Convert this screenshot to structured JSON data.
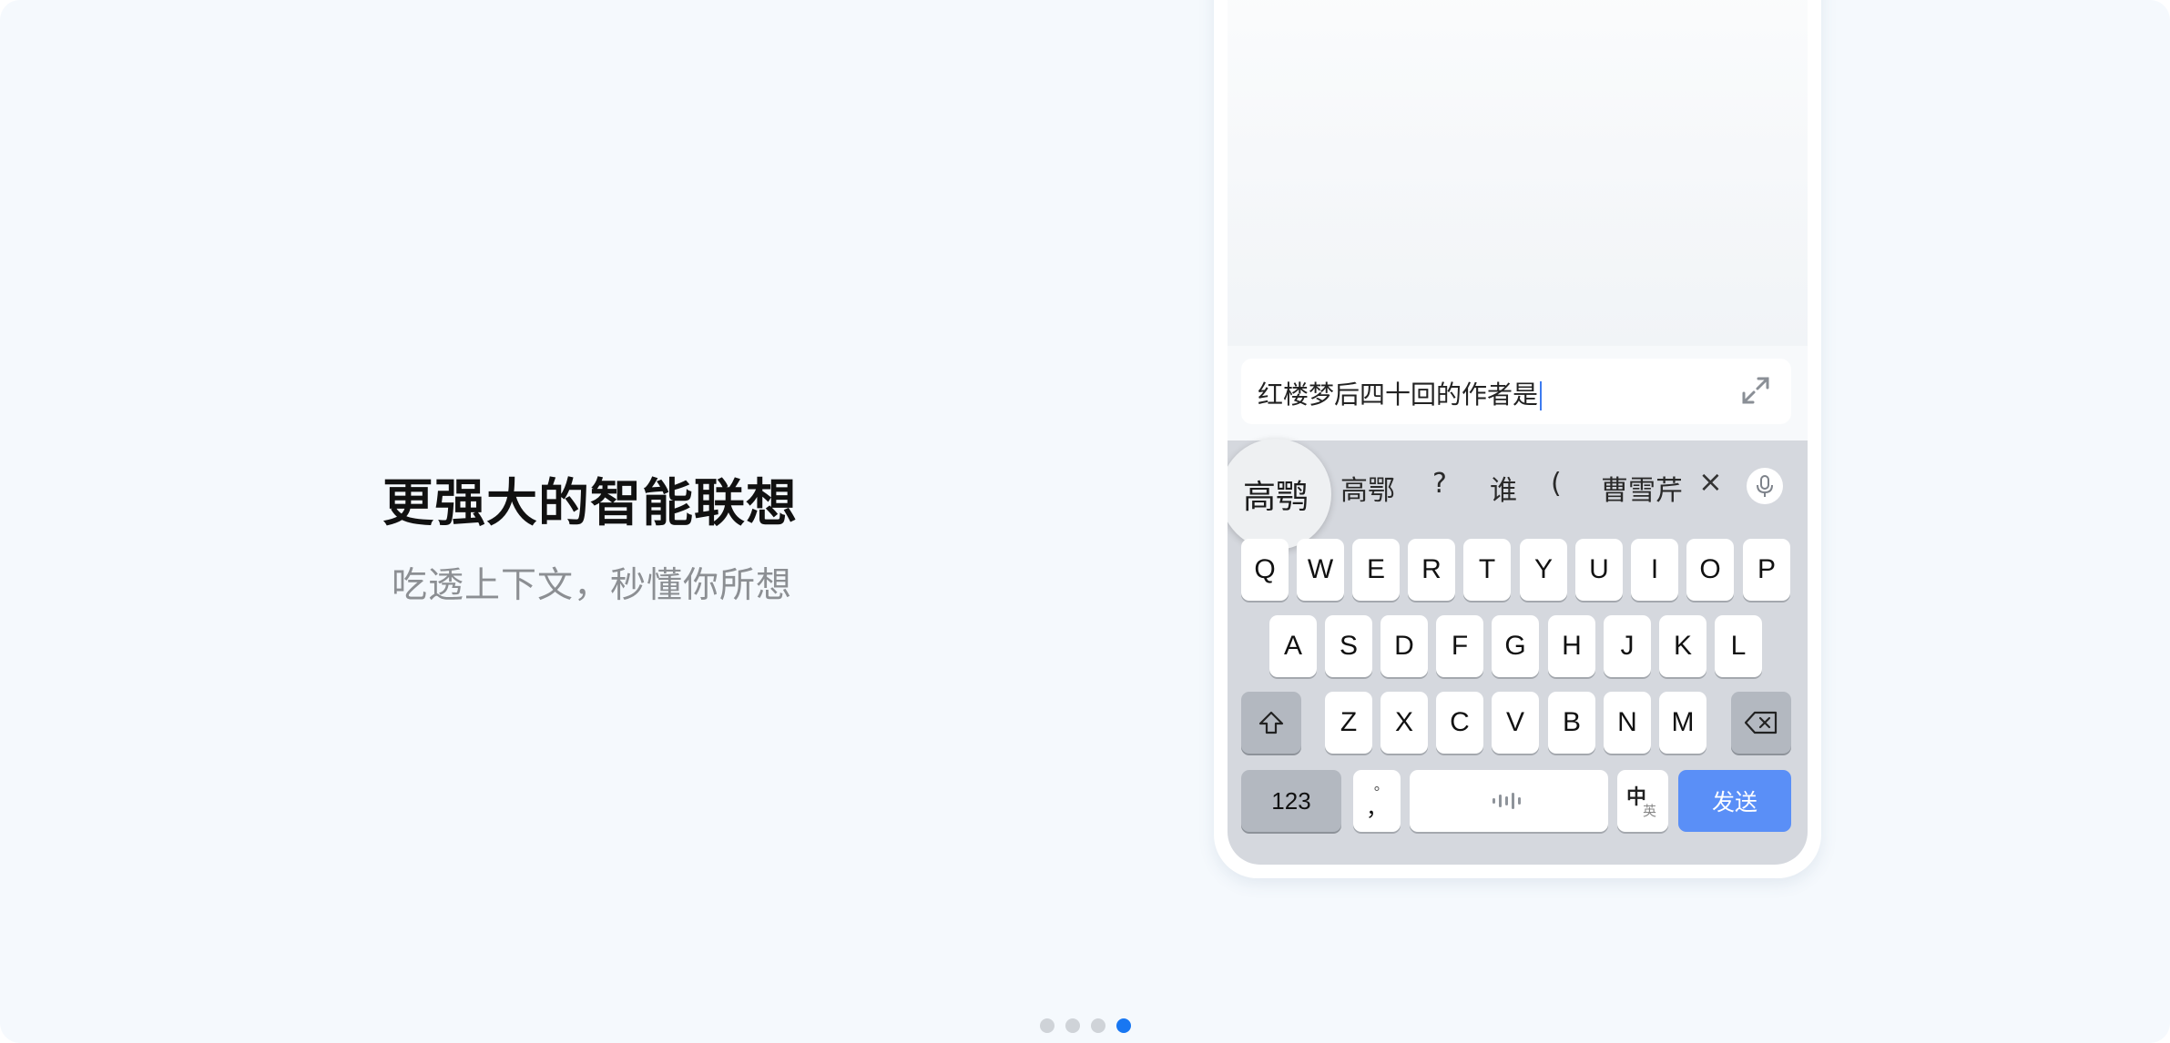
{
  "headline": "更强大的智能联想",
  "subheadline": "吃透上下文，秒懂你所想",
  "chat_input": {
    "text": "红楼梦后四十回的作者是",
    "expand_icon": "expand-arrows-icon"
  },
  "candidates": {
    "highlighted": "高鹗",
    "items": [
      "高鄂",
      "?",
      "谁",
      "(",
      "曹雪芹"
    ],
    "close_label": "×",
    "voice_icon": "microphone-icon"
  },
  "keyboard": {
    "row1": [
      "Q",
      "W",
      "E",
      "R",
      "T",
      "Y",
      "U",
      "I",
      "O",
      "P"
    ],
    "row2": [
      "A",
      "S",
      "D",
      "F",
      "G",
      "H",
      "J",
      "K",
      "L"
    ],
    "row3": [
      "Z",
      "X",
      "C",
      "V",
      "B",
      "N",
      "M"
    ],
    "shift_icon": "shift-arrow-icon",
    "backspace_icon": "backspace-icon",
    "numbers_label": "123",
    "punct_label_top": "°",
    "punct_label": "，",
    "space_icon": "voice-wave-icon",
    "lang_primary": "中",
    "lang_secondary": "英",
    "send_label": "发送"
  },
  "pagination": {
    "total": 4,
    "active_index": 3
  },
  "colors": {
    "background": "#f5f9fd",
    "accent": "#1877f2",
    "send_button": "#5a8ff7"
  }
}
